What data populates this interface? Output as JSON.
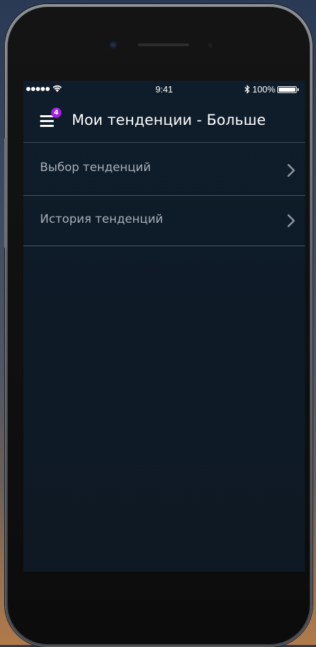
{
  "status_bar": {
    "time": "9:41",
    "battery_text": "100%",
    "signal_bars": 5
  },
  "header": {
    "title": "Мои тенденции - Больше",
    "menu_badge": "4"
  },
  "list": {
    "items": [
      {
        "label": "Выбор тенденций",
        "icon": "chevron-right-icon"
      },
      {
        "label": "История тенденций",
        "icon": "chevron-right-icon"
      }
    ]
  },
  "colors": {
    "screen_background": "#0e1a26",
    "badge": "#a020e0",
    "list_text": "#a9b1b9",
    "divider": "#4a5663"
  }
}
